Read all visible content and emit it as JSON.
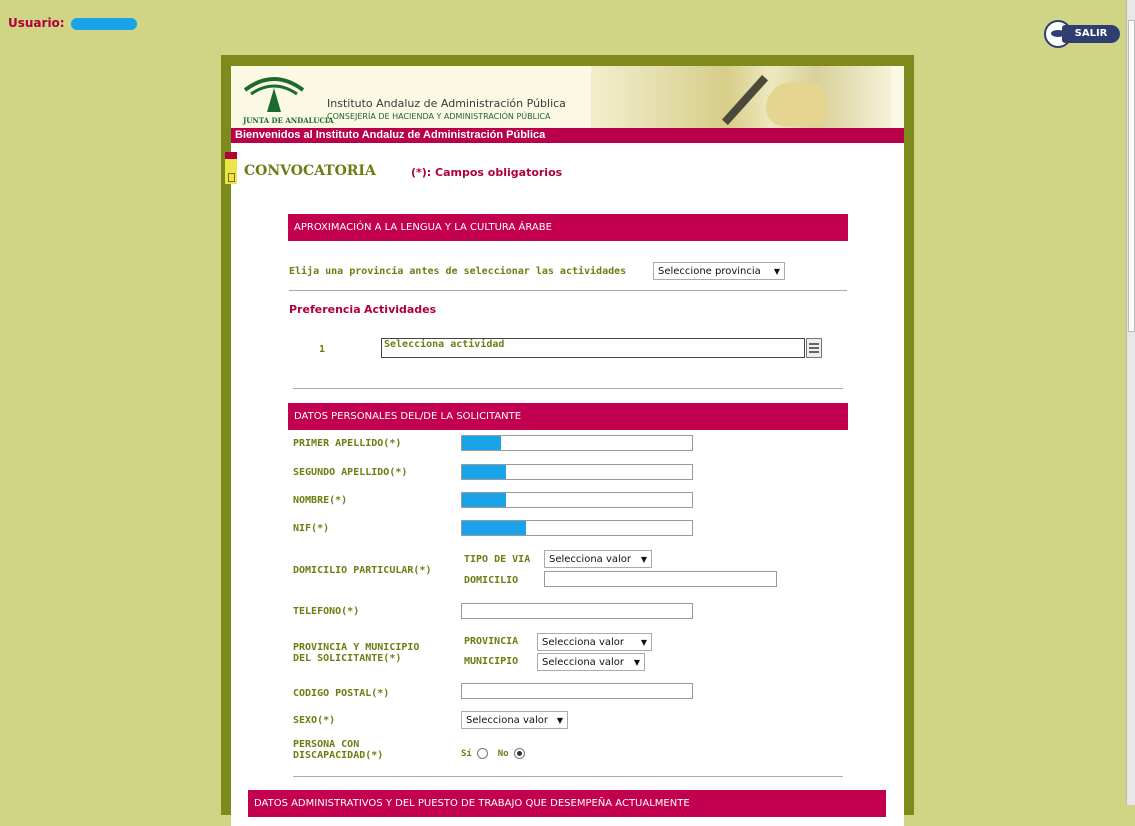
{
  "top": {
    "user_label": "Usuario:",
    "exit_label": "SALIR"
  },
  "header": {
    "logo_text": "JUNTA DE ANDALUCIA",
    "institute": "Instituto Andaluz de Administración Pública",
    "council": "CONSEJERÍA DE HACIENDA Y ADMINISTRACIÓN PÚBLICA",
    "welcome": "Bienvenidos al Instituto Andaluz de Administración Pública"
  },
  "page": {
    "title": "CONVOCATORIA",
    "required_note": "(*): Campos obligatorios"
  },
  "course": {
    "section_title": "APROXIMACIÓN A LA LENGUA Y LA CULTURA ÁRABE",
    "province_prompt": "Elija una provincia antes de seleccionar las actividades",
    "province_select": "Seleccione provincia",
    "preference_header": "Preferencia",
    "activities_header": "Actividades",
    "row_number": "1",
    "activity_placeholder": "Selecciona actividad"
  },
  "personal": {
    "section_title": "DATOS PERSONALES DEL/DE LA SOLICITANTE",
    "first_surname": {
      "label": "PRIMER APELLIDO(*)",
      "mask_fraction": 0.17
    },
    "second_surname": {
      "label": "SEGUNDO APELLIDO(*)",
      "mask_fraction": 0.19
    },
    "name": {
      "label": "NOMBRE(*)",
      "mask_fraction": 0.19
    },
    "nif": {
      "label": "NIF(*)",
      "mask_fraction": 0.28
    },
    "address_label": "DOMICILIO PARTICULAR(*)",
    "road_type_label": "TIPO DE VIA",
    "road_type_select": "Selecciona valor",
    "domicile_label": "DOMICILIO",
    "phone_label": "TELEFONO(*)",
    "prov_mun_label_1": "PROVINCIA Y MUNICIPIO",
    "prov_mun_label_2": "DEL SOLICITANTE(*)",
    "province_label": "PROVINCIA",
    "province_select": "Selecciona valor",
    "municipality_label": "MUNICIPIO",
    "municipality_select": "Selecciona valor",
    "postal_label": "CODIGO POSTAL(*)",
    "sex_label": "SEXO(*)",
    "sex_select": "Selecciona valor",
    "disability_label_1": "PERSONA CON",
    "disability_label_2": "DISCAPACIDAD(*)",
    "yes_label": "Sí",
    "no_label": "No",
    "disability_value": "No"
  },
  "admin": {
    "section_title": "DATOS ADMINISTRATIVOS Y DEL PUESTO DE TRABAJO QUE DESEMPEÑA ACTUALMENTE"
  }
}
